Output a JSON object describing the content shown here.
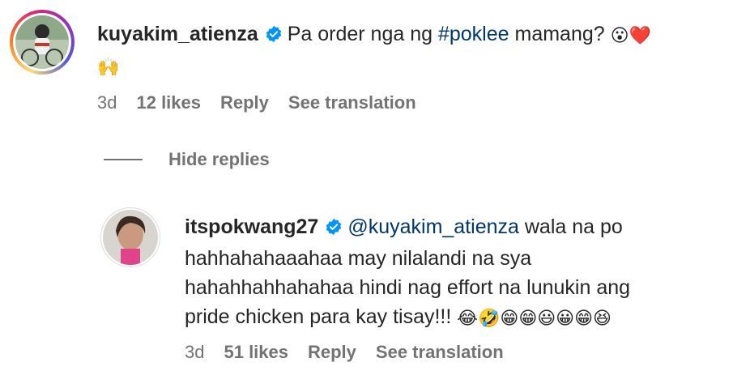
{
  "comment": {
    "username": "kuyakim_atienza",
    "text_prefix": "Pa order nga ng ",
    "hashtag": "#poklee",
    "text_suffix": " mamang?",
    "emojis_line1": "😮❤️",
    "emojis_line2": "🙌",
    "time": "3d",
    "likes": "12 likes",
    "reply_label": "Reply",
    "translation_label": "See translation"
  },
  "replies_toggle": {
    "label": "Hide replies"
  },
  "reply": {
    "username": "itspokwang27",
    "mention": "@kuyakim_atienza",
    "line1": " wala na po",
    "line2": "hahhahahaaahaa may nilalandi na sya",
    "line3": "hahahhahhahahaa hindi nag effort na lunukin ang",
    "line4": "pride chicken para kay tisay!!! ",
    "emojis": "😂🤣😁😁😃😀😁😆",
    "time": "3d",
    "likes": "51 likes",
    "reply_label": "Reply",
    "translation_label": "See translation"
  },
  "colors": {
    "verified": "#0095f6",
    "link": "#00376b",
    "meta": "#737373"
  }
}
